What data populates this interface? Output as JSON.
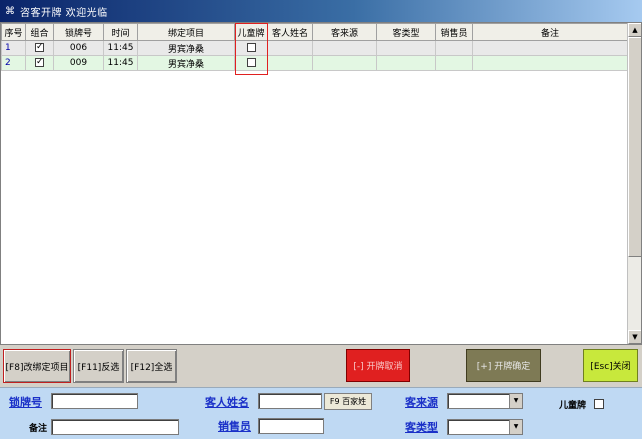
{
  "window": {
    "title": "咨客开牌  欢迎光临",
    "icon": "app-menu-icon"
  },
  "grid": {
    "columns": [
      "序号",
      "组合",
      "锁牌号",
      "时间",
      "绑定项目",
      "儿童牌",
      "客人姓名",
      "客来源",
      "客类型",
      "销售员",
      "备注"
    ],
    "rows": [
      {
        "seq": "1",
        "combo": "✓",
        "lock_no": "006",
        "time": "11:45",
        "project": "男宾净桑",
        "kid": "",
        "guest": "",
        "source": "",
        "type": "",
        "sales": "",
        "note": ""
      },
      {
        "seq": "2",
        "combo": "✓",
        "lock_no": "009",
        "time": "11:45",
        "project": "男宾净桑",
        "kid": "",
        "guest": "",
        "source": "",
        "type": "",
        "sales": "",
        "note": ""
      }
    ]
  },
  "buttons": {
    "change_project": "[F8]改绑定项目",
    "invert": "[F11]反选",
    "select_all": "[F12]全选",
    "cancel_open": "[-] 开牌取消",
    "confirm_open": "[+] 开牌确定",
    "close": "[Esc]关闭"
  },
  "form": {
    "lock_no_label": "锁牌号",
    "guest_name_label": "客人姓名",
    "f9_button": "F9 百家姓",
    "source_label": "客来源",
    "kid_label": "儿童牌",
    "note_label": "备注",
    "sales_label": "销售员",
    "type_label": "客类型"
  },
  "colors": {
    "cancel": "#e02020",
    "confirm": "#7e7a55",
    "close": "#c8e83c",
    "form_bg": "#bfd9f3",
    "link": "#1a30c8"
  }
}
